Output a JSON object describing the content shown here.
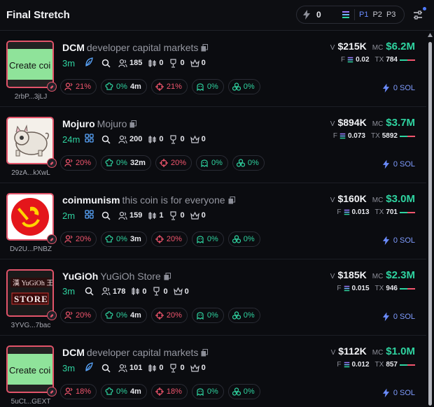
{
  "header": {
    "title": "Final Stretch",
    "quick_buy_value": "0",
    "presets": [
      "P1",
      "P2",
      "P3"
    ],
    "active_preset": "P1"
  },
  "tokens": [
    {
      "ticker": "DCM",
      "name": "developer capital markets",
      "address": "2rbP...3jLJ",
      "image_text": "Create coi",
      "age": "3m",
      "social": "feather-icon",
      "holders": "185",
      "candles": "0",
      "trophy": "0",
      "crown": "0",
      "top10": "21%",
      "dev_pct": "0%",
      "dev_age": "4m",
      "snipers": "21%",
      "insiders": "0%",
      "bundles": "0%",
      "volume": "$215K",
      "market_cap": "$6.2M",
      "fee": "0.02",
      "tx": "784",
      "tx_buy_ratio": 0.5,
      "buy_amount": "0 SOL"
    },
    {
      "ticker": "Mojuro",
      "name": "Mojuro",
      "address": "29zA...kXwL",
      "image_text": "",
      "age": "24m",
      "social": "community-icon",
      "holders": "200",
      "candles": "0",
      "trophy": "0",
      "crown": "0",
      "top10": "20%",
      "dev_pct": "0%",
      "dev_age": "32m",
      "snipers": "20%",
      "insiders": "0%",
      "bundles": "0%",
      "volume": "$894K",
      "market_cap": "$3.7M",
      "fee": "0.073",
      "tx": "5892",
      "tx_buy_ratio": 0.5,
      "buy_amount": "0 SOL"
    },
    {
      "ticker": "coinmunism",
      "name": "this coin is for everyone",
      "address": "Dv2U...PNBZ",
      "image_text": "",
      "age": "2m",
      "social": "community-icon",
      "holders": "159",
      "candles": "1",
      "trophy": "0",
      "crown": "0",
      "top10": "20%",
      "dev_pct": "0%",
      "dev_age": "3m",
      "snipers": "20%",
      "insiders": "0%",
      "bundles": "0%",
      "volume": "$160K",
      "market_cap": "$3.0M",
      "fee": "0.013",
      "tx": "701",
      "tx_buy_ratio": 0.5,
      "buy_amount": "0 SOL"
    },
    {
      "ticker": "YuGiOh",
      "name": "YuGiOh Store",
      "address": "3YVG...7bac",
      "image_text": "STORE",
      "age": "3m",
      "social": "",
      "holders": "178",
      "candles": "0",
      "trophy": "0",
      "crown": "0",
      "top10": "20%",
      "dev_pct": "0%",
      "dev_age": "4m",
      "snipers": "20%",
      "insiders": "0%",
      "bundles": "0%",
      "volume": "$185K",
      "market_cap": "$2.3M",
      "fee": "0.015",
      "tx": "946",
      "tx_buy_ratio": 0.5,
      "buy_amount": "0 SOL"
    },
    {
      "ticker": "DCM",
      "name": "developer capital markets",
      "address": "5uCt...GEXT",
      "image_text": "Create coi",
      "age": "3m",
      "social": "feather-icon",
      "holders": "101",
      "candles": "0",
      "trophy": "0",
      "crown": "0",
      "top10": "18%",
      "dev_pct": "0%",
      "dev_age": "4m",
      "snipers": "18%",
      "insiders": "0%",
      "bundles": "0%",
      "volume": "$112K",
      "market_cap": "$1.0M",
      "fee": "0.012",
      "tx": "857",
      "tx_buy_ratio": 0.5,
      "buy_amount": "0 SOL"
    }
  ],
  "colors": {
    "accent": "#6b8cff",
    "positive": "#2fd3a0",
    "negative": "#f2566e",
    "background": "#0b0c10"
  }
}
